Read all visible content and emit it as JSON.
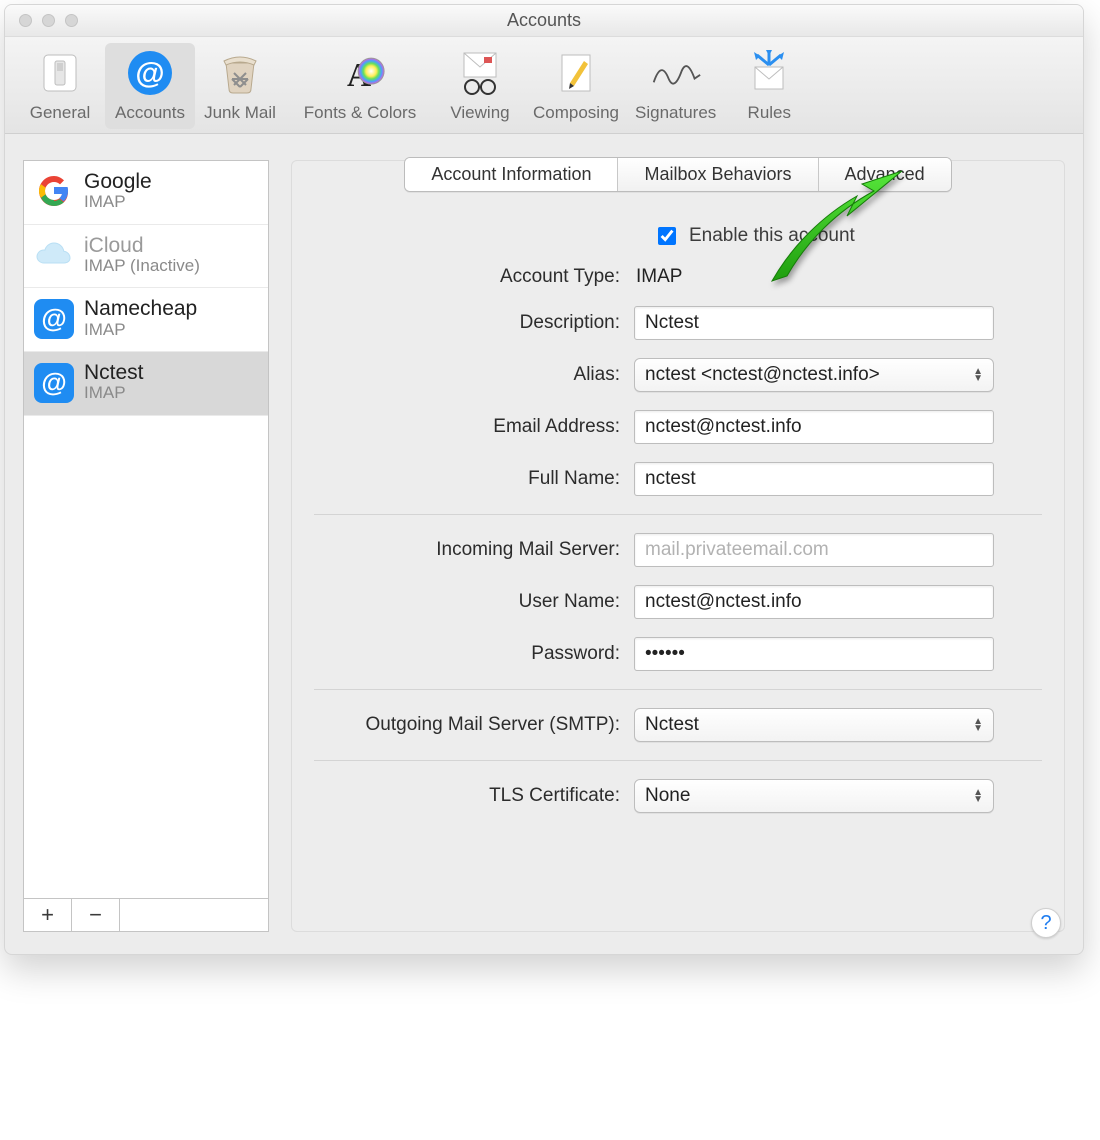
{
  "window": {
    "title": "Accounts"
  },
  "toolbar": {
    "items": [
      {
        "label": "General"
      },
      {
        "label": "Accounts"
      },
      {
        "label": "Junk Mail"
      },
      {
        "label": "Fonts & Colors"
      },
      {
        "label": "Viewing"
      },
      {
        "label": "Composing"
      },
      {
        "label": "Signatures"
      },
      {
        "label": "Rules"
      }
    ],
    "active_index": 1
  },
  "sidebar": {
    "accounts": [
      {
        "name": "Google",
        "sub": "IMAP",
        "icon": "google"
      },
      {
        "name": "iCloud",
        "sub": "IMAP (Inactive)",
        "icon": "icloud"
      },
      {
        "name": "Namecheap",
        "sub": "IMAP",
        "icon": "at-blue"
      },
      {
        "name": "Nctest",
        "sub": "IMAP",
        "icon": "at-blue"
      }
    ],
    "selected_index": 3,
    "add_label": "+",
    "remove_label": "−"
  },
  "tabs": {
    "items": [
      "Account Information",
      "Mailbox Behaviors",
      "Advanced"
    ],
    "active_index": 0
  },
  "form": {
    "enable_label": "Enable this account",
    "enable_checked": true,
    "account_type_label": "Account Type:",
    "account_type_value": "IMAP",
    "description_label": "Description:",
    "description_value": "Nctest",
    "alias_label": "Alias:",
    "alias_value": "nctest <nctest@nctest.info>",
    "email_label": "Email Address:",
    "email_value": "nctest@nctest.info",
    "fullname_label": "Full Name:",
    "fullname_value": "nctest",
    "incoming_label": "Incoming Mail Server:",
    "incoming_value": "mail.privateemail.com",
    "username_label": "User Name:",
    "username_value": "nctest@nctest.info",
    "password_label": "Password:",
    "password_value": "••••••",
    "smtp_label": "Outgoing Mail Server (SMTP):",
    "smtp_value": "Nctest",
    "tls_label": "TLS Certificate:",
    "tls_value": "None"
  },
  "help": {
    "label": "?"
  }
}
